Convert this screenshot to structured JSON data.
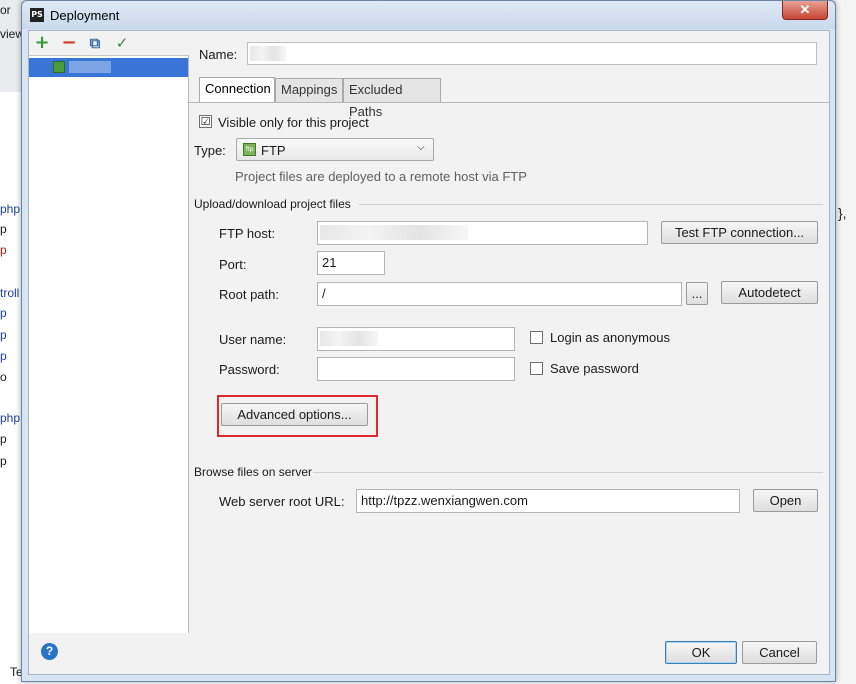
{
  "background": {
    "top_left_text": "or",
    "view_text": "view",
    "left_fragments": [
      "php",
      "p",
      "p",
      "troll",
      "p",
      "p",
      "p",
      "o",
      "php",
      "p",
      "p"
    ],
    "right_fragment": "},",
    "bottom_left_text": "Te"
  },
  "window": {
    "title": "Deployment",
    "app_icon_text": "PS",
    "close_glyph": "✕"
  },
  "left_toolbar": {
    "add_glyph": "+",
    "remove_glyph": "−",
    "copy_glyph": "⧉",
    "check_glyph": "✓"
  },
  "form": {
    "name_label": "Name:",
    "tabs": [
      {
        "label": "Connection",
        "active": true
      },
      {
        "label": "Mappings",
        "active": false
      },
      {
        "label": "Excluded Paths",
        "active": false
      }
    ],
    "visible_only_label": "Visible only for this project",
    "visible_only_checked": "☑",
    "type_label": "Type:",
    "type_icon_text": "ftp",
    "type_value": "FTP",
    "type_chevron": "⌵",
    "type_hint": "Project files are deployed to a remote host via FTP",
    "upload_section": "Upload/download project files",
    "ftp_host_label": "FTP host:",
    "test_connection_label": "Test FTP connection...",
    "port_label": "Port:",
    "port_value": "21",
    "root_path_label": "Root path:",
    "root_path_value": "/",
    "browse_label": "...",
    "autodetect_label": "Autodetect",
    "username_label": "User name:",
    "anonymous_label": "Login as anonymous",
    "password_label": "Password:",
    "save_password_label": "Save password",
    "advanced_label": "Advanced options...",
    "browse_section": "Browse files on server",
    "web_root_label": "Web server root URL:",
    "web_root_value": "http://tpzz.wenxiangwen.com",
    "open_label": "Open"
  },
  "footer": {
    "help_glyph": "?",
    "ok_label": "OK",
    "cancel_label": "Cancel"
  }
}
